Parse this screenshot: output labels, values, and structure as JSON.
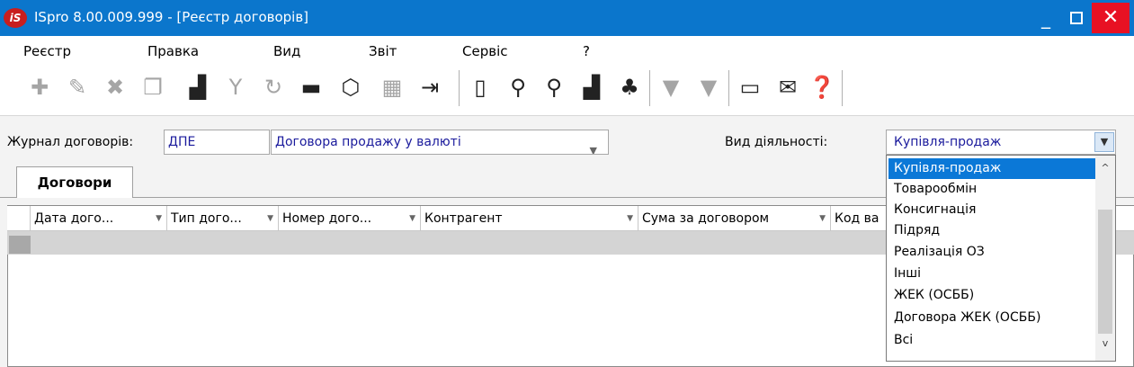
{
  "window": {
    "logo_text": "iS",
    "title": "ISpro 8.00.009.999 - [Реєстр договорів]",
    "minimize_glyph": "_",
    "close_glyph": "✕"
  },
  "menu": [
    "Реєстр",
    "Правка",
    "Вид",
    "Звіт",
    "Сервіс",
    "?"
  ],
  "toolbar": {
    "icons": [
      "add-icon",
      "edit-icon",
      "delete-icon",
      "copy-icon",
      "user-card-icon",
      "filter-icon",
      "refresh-icon",
      "print-icon",
      "package-icon",
      "excel-icon",
      "export-icon",
      "book-icon",
      "search-icon",
      "search-next-icon",
      "user-search-icon",
      "tree-icon",
      "filter-funnel-icon",
      "clear-filter-icon",
      "document-icon",
      "mail-icon",
      "help-icon"
    ]
  },
  "filters": {
    "journal_label": "Журнал договорів:",
    "journal_code": "ДПЕ",
    "journal_name": "Договора продажу у валюті",
    "activity_label": "Вид діяльності:",
    "activity_value": "Купівля-продаж"
  },
  "tabs": [
    "Договори"
  ],
  "grid": {
    "columns": [
      "Дата дого...",
      "Тип дого...",
      "Номер дого...",
      "Контрагент",
      "Сума за договором",
      "Код ва"
    ]
  },
  "dropdown": {
    "options": [
      "Купівля-продаж",
      "Товарообмін",
      "Консигнація",
      "Підряд",
      "Реалізація ОЗ",
      "Інші",
      "ЖЕК (ОСББ)",
      "Договора ЖЕК (ОСББ)",
      "Всі"
    ],
    "selected": "Купівля-продаж"
  }
}
